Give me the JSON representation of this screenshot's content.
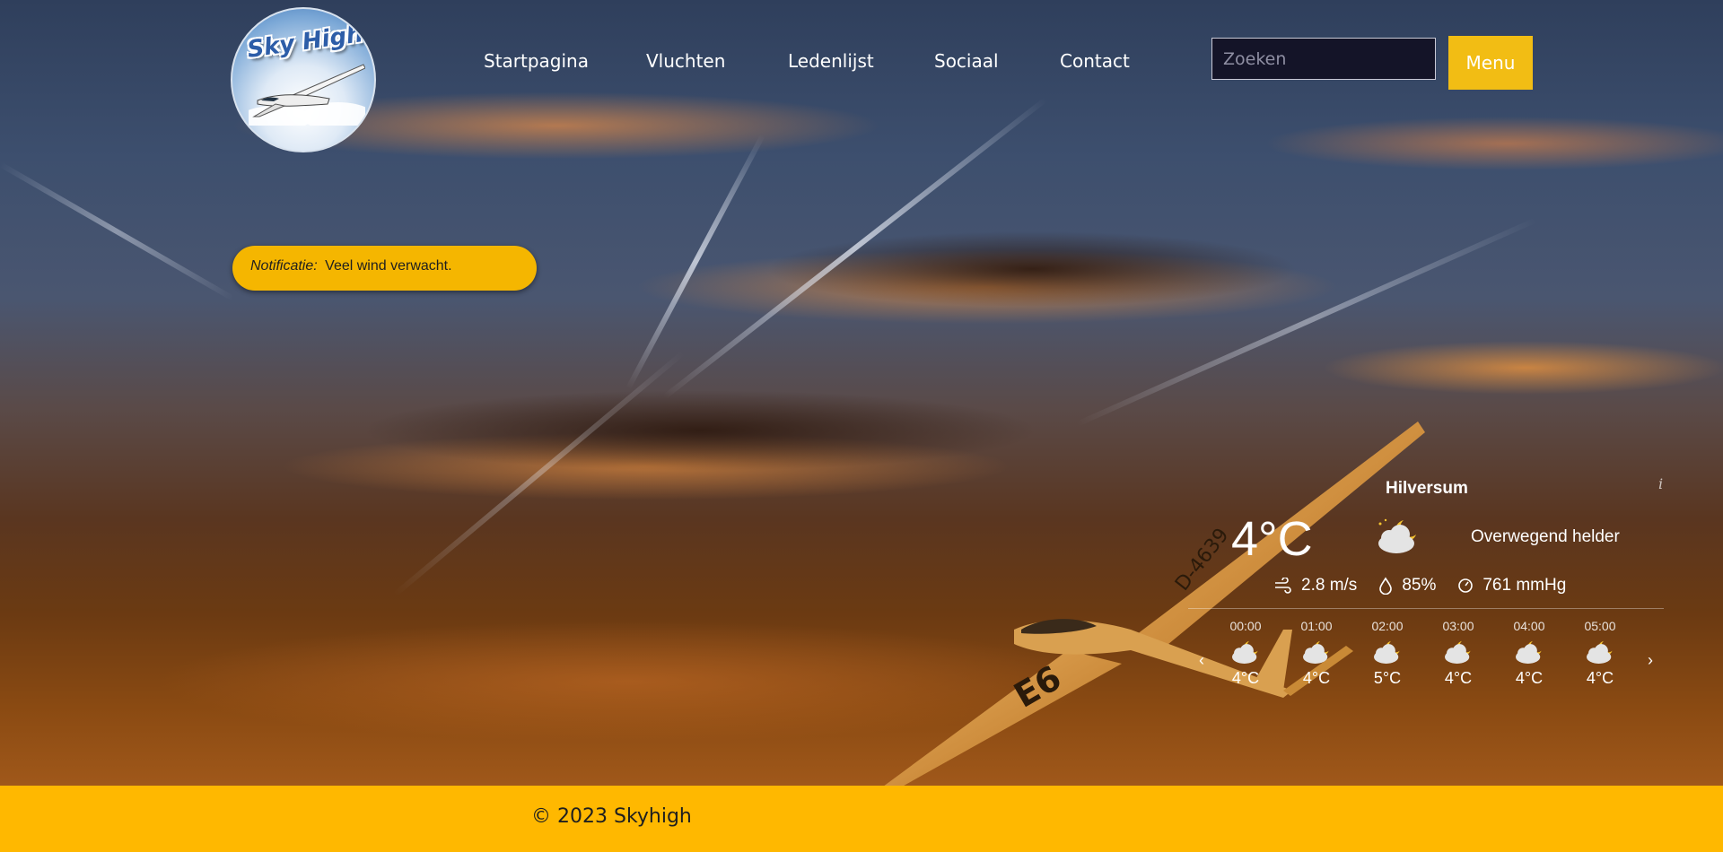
{
  "logo": {
    "text": "Sky High"
  },
  "nav": {
    "items": [
      {
        "label": "Startpagina"
      },
      {
        "label": "Vluchten"
      },
      {
        "label": "Ledenlijst"
      },
      {
        "label": "Sociaal"
      },
      {
        "label": "Contact"
      }
    ]
  },
  "search": {
    "placeholder": "Zoeken"
  },
  "menu": {
    "label": "Menu"
  },
  "notification": {
    "prefix": "Notificatie:",
    "message": "Veel wind verwacht."
  },
  "weather": {
    "city": "Hilversum",
    "info_icon": "i",
    "temperature": "4°C",
    "condition_icon": "partly-cloudy-night-icon",
    "description": "Overwegend helder",
    "wind": "2.8 m/s",
    "humidity": "85%",
    "pressure": "761 mmHg",
    "prev_arrow": "‹",
    "next_arrow": "›",
    "hours": [
      {
        "time": "00:00",
        "temp": "4°C"
      },
      {
        "time": "01:00",
        "temp": "4°C"
      },
      {
        "time": "02:00",
        "temp": "5°C"
      },
      {
        "time": "03:00",
        "temp": "4°C"
      },
      {
        "time": "04:00",
        "temp": "4°C"
      },
      {
        "time": "05:00",
        "temp": "4°C"
      }
    ]
  },
  "footer": {
    "text": "© 2023 Skyhigh"
  },
  "colors": {
    "accent_yellow": "#ffb800",
    "menu_yellow": "#f2bd14",
    "notification_yellow": "#f5b600",
    "search_bg": "#141428"
  },
  "background": {
    "glider_registration": "D-4639",
    "glider_tail_code": "E6"
  }
}
